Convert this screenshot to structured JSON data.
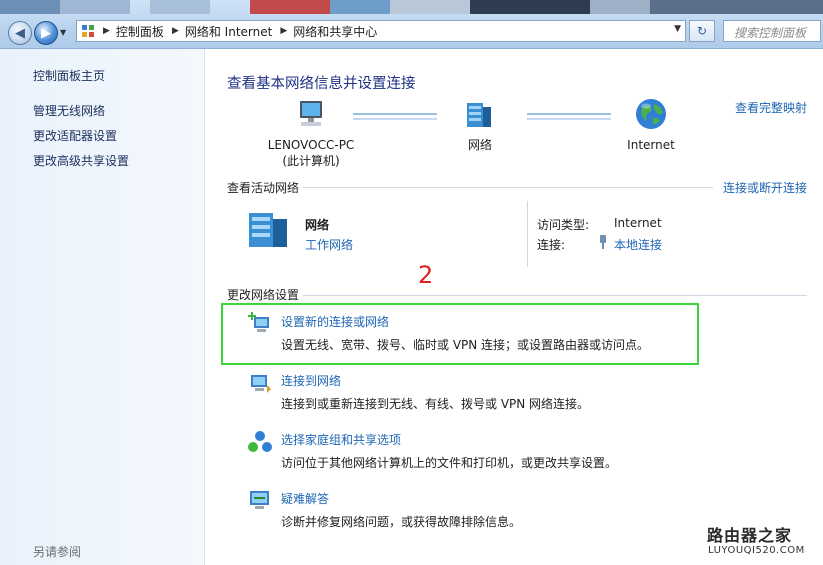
{
  "window": {
    "breadcrumb": [
      "控制面板",
      "网络和 Internet",
      "网络和共享中心"
    ],
    "search_placeholder": "搜索控制面板",
    "colors": {
      "accent": "#1e66b4",
      "title": "#1e3287",
      "highlight_box": "#3bd43b",
      "annotation": "#e02020"
    }
  },
  "sidebar": {
    "items": [
      {
        "label": "控制面板主页"
      },
      {
        "label": "管理无线网络"
      },
      {
        "label": "更改适配器设置"
      },
      {
        "label": "更改高级共享设置"
      }
    ],
    "see_also": "另请参阅"
  },
  "main": {
    "title": "查看基本网络信息并设置连接",
    "full_map_link": "查看完整映射",
    "map_nodes": [
      {
        "label": "LENOVOCC-PC",
        "sub": "(此计算机)",
        "icon": "computer-icon"
      },
      {
        "label": "网络",
        "sub": "",
        "icon": "network-icon"
      },
      {
        "label": "Internet",
        "sub": "",
        "icon": "globe-icon"
      }
    ],
    "active_networks": {
      "header": "查看活动网络",
      "connect_link": "连接或断开连接",
      "network_name": "网络",
      "network_type": "工作网络",
      "access_type_label": "访问类型:",
      "access_type_value": "Internet",
      "connection_label": "连接:",
      "connection_value": "本地连接"
    },
    "change_settings": {
      "header": "更改网络设置",
      "annotation_number": "2",
      "tasks": [
        {
          "title": "设置新的连接或网络",
          "desc": "设置无线、宽带、拨号、临时或 VPN 连接；或设置路由器或访问点。",
          "icon": "new-connection-icon"
        },
        {
          "title": "连接到网络",
          "desc": "连接到或重新连接到无线、有线、拨号或 VPN 网络连接。",
          "icon": "connect-network-icon"
        },
        {
          "title": "选择家庭组和共享选项",
          "desc": "访问位于其他网络计算机上的文件和打印机，或更改共享设置。",
          "icon": "homegroup-icon"
        },
        {
          "title": "疑难解答",
          "desc": "诊断并修复网络问题，或获得故障排除信息。",
          "icon": "troubleshoot-icon"
        }
      ]
    }
  },
  "watermark": {
    "line1": "路由器之家",
    "line2": "LUYOUQI520.COM"
  }
}
